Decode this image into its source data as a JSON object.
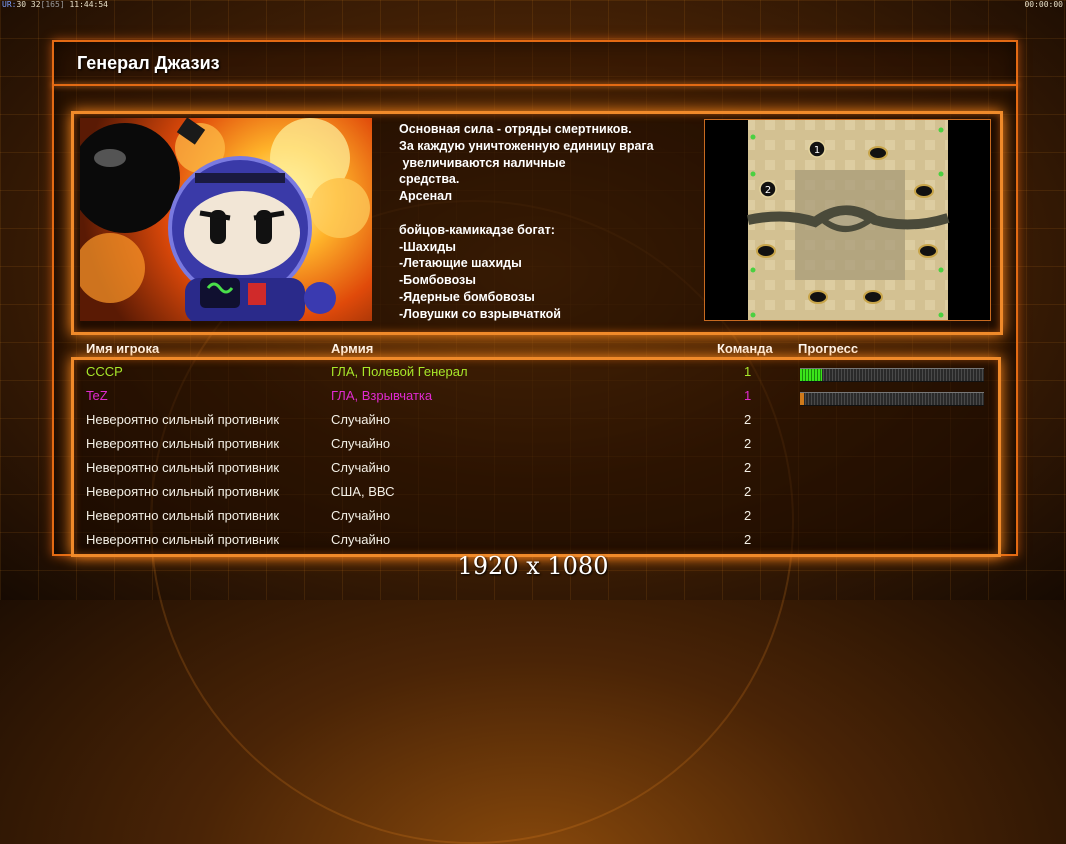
{
  "status": {
    "ur_label": "UR:",
    "left_numbers": "30 32",
    "bracket_value": "[165]",
    "clock": "11:44:54",
    "timer": "00:00:00"
  },
  "general": {
    "name": "Генерал Джазиз",
    "description": "Основная сила - отряды смертников.\nЗа каждую уничтоженную единицу врага\n увеличиваются наличные\nсредства.\nАрсенал\n\nбойцов-камикадзе богат:\n-Шахиды\n-Летающие шахиды\n-Бомбовозы\n-Ядерные бомбовозы\n-Ловушки со взрывчаткой"
  },
  "map": {
    "start_markers": [
      "1",
      "2"
    ]
  },
  "table": {
    "headers": {
      "player": "Имя игрока",
      "army": "Армия",
      "team": "Команда",
      "progress": "Прогресс"
    },
    "rows": [
      {
        "name": "CCCP",
        "army": "ГЛА, Полевой Генерал",
        "team": "1",
        "progress": 0.12,
        "color": "#a8e82a",
        "team_color": "#a8e82a"
      },
      {
        "name": "TeZ",
        "army": "ГЛА, Взрывчатка",
        "team": "1",
        "progress": 0.02,
        "color": "#e02ad0",
        "team_color": "#e02ad0"
      },
      {
        "name": "Невероятно сильный противник",
        "army": "Случайно",
        "team": "2",
        "color": "#f4f0e6",
        "team_color": "#f4f0e6"
      },
      {
        "name": "Невероятно сильный противник",
        "army": "Случайно",
        "team": "2",
        "color": "#f4f0e6",
        "team_color": "#f4f0e6"
      },
      {
        "name": "Невероятно сильный противник",
        "army": "Случайно",
        "team": "2",
        "color": "#f4f0e6",
        "team_color": "#f4f0e6"
      },
      {
        "name": "Невероятно сильный противник",
        "army": "США, ВВС",
        "team": "2",
        "color": "#f4f0e6",
        "team_color": "#f4f0e6"
      },
      {
        "name": "Невероятно сильный противник",
        "army": "Случайно",
        "team": "2",
        "color": "#f4f0e6",
        "team_color": "#f4f0e6"
      },
      {
        "name": "Невероятно сильный противник",
        "army": "Случайно",
        "team": "2",
        "color": "#f4f0e6",
        "team_color": "#f4f0e6"
      }
    ]
  },
  "resolution_label": "1920 x 1080",
  "colors": {
    "accent": "#f08a2a",
    "progress_green": "#3be61a"
  }
}
